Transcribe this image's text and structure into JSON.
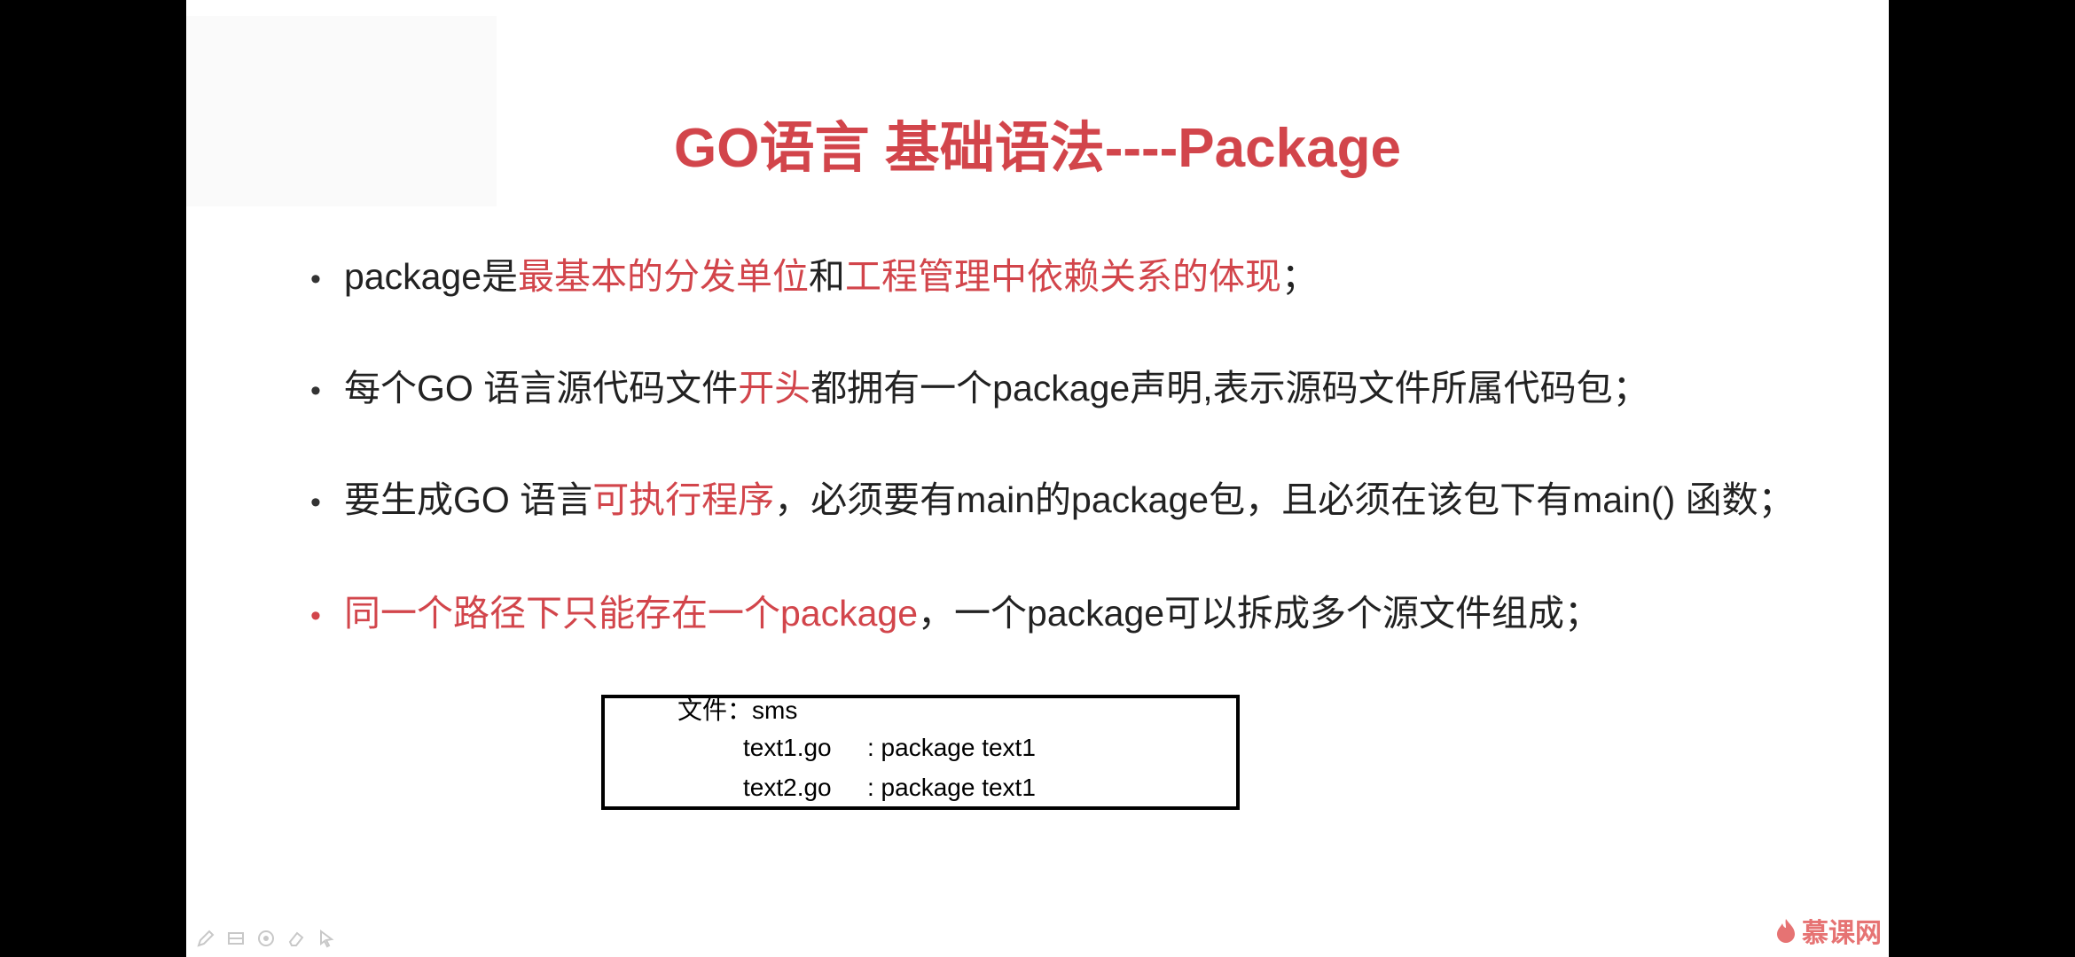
{
  "slide": {
    "title": "GO语言 基础语法----Package",
    "bullets": [
      {
        "parts": [
          {
            "text": "package是",
            "highlight": false
          },
          {
            "text": "最基本的分发单位",
            "highlight": true
          },
          {
            "text": "和",
            "highlight": false
          },
          {
            "text": "工程管理中依赖关系的体现",
            "highlight": true
          },
          {
            "text": "；",
            "highlight": false
          }
        ]
      },
      {
        "parts": [
          {
            "text": "每个GO 语言源代码文件",
            "highlight": false
          },
          {
            "text": "开头",
            "highlight": true
          },
          {
            "text": "都拥有一个package声明,表示源码文件所属代码包；",
            "highlight": false
          }
        ]
      },
      {
        "parts": [
          {
            "text": "要生成GO 语言",
            "highlight": false
          },
          {
            "text": "可执行程序",
            "highlight": true
          },
          {
            "text": "，必须要有main的package包，且必须在该包下有main() 函数；",
            "highlight": false
          }
        ]
      },
      {
        "parts": [
          {
            "text": "同一个路径下只能存在一个package",
            "highlight": true
          },
          {
            "text": "，一个package可以拆成多个源文件组成；",
            "highlight": false
          }
        ]
      }
    ],
    "code_box": {
      "folder_line": "文件：sms",
      "files": [
        {
          "name": "text1.go",
          "package": ": package text1"
        },
        {
          "name": "text2.go",
          "package": ": package text1"
        }
      ]
    },
    "logo_text": "慕课网"
  },
  "toolbar": {
    "icons": [
      "pen-icon",
      "grid-icon",
      "circle-icon",
      "eraser-icon",
      "pointer-icon"
    ]
  },
  "colors": {
    "accent_red": "#d2454b",
    "background": "#000000",
    "slide": "#ffffff"
  }
}
